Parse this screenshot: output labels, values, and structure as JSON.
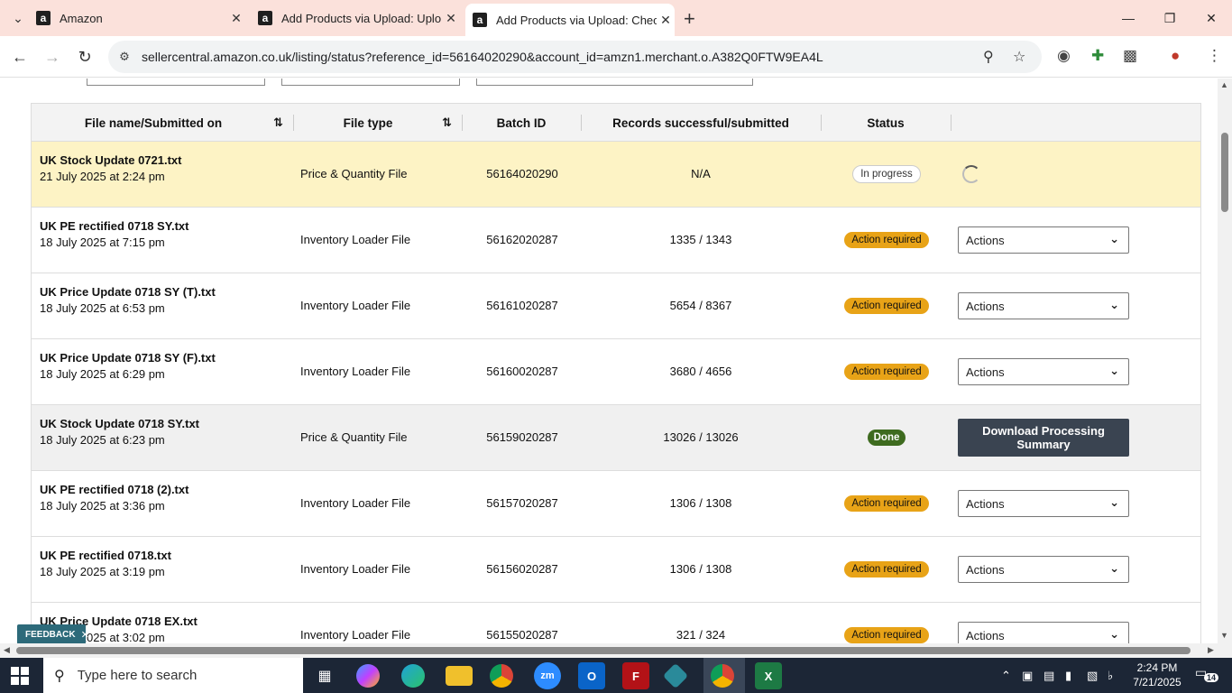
{
  "browser": {
    "tabs": [
      {
        "title": "Amazon",
        "favicon": "a"
      },
      {
        "title": "Add Products via Upload: Uplo",
        "favicon": "a"
      },
      {
        "title": "Add Products via Upload: Chec",
        "favicon": "a",
        "active": true
      }
    ],
    "url": "sellercentral.amazon.co.uk/listing/status?reference_id=56164020290&account_id=amzn1.merchant.o.A382Q0FTW9EA4L"
  },
  "table": {
    "headers": {
      "file": "File name/Submitted on",
      "type": "File type",
      "batch": "Batch ID",
      "records": "Records successful/submitted",
      "status": "Status"
    },
    "rows": [
      {
        "name": "UK Stock Update 0721.txt",
        "date": "21 July 2025 at 2:24 pm",
        "type": "Price & Quantity File",
        "batch": "56164020290",
        "records": "N/A",
        "status": "In progress",
        "action": "spinner"
      },
      {
        "name": "UK PE rectified 0718 SY.txt",
        "date": "18 July 2025 at 7:15 pm",
        "type": "Inventory Loader File",
        "batch": "56162020287",
        "records": "1335 / 1343",
        "status": "Action required",
        "action": "Actions"
      },
      {
        "name": "UK Price Update 0718 SY (T).txt",
        "date": "18 July 2025 at 6:53 pm",
        "type": "Inventory Loader File",
        "batch": "56161020287",
        "records": "5654 / 8367",
        "status": "Action required",
        "action": "Actions"
      },
      {
        "name": "UK Price Update 0718 SY (F).txt",
        "date": "18 July 2025 at 6:29 pm",
        "type": "Inventory Loader File",
        "batch": "56160020287",
        "records": "3680 / 4656",
        "status": "Action required",
        "action": "Actions"
      },
      {
        "name": "UK Stock Update 0718 SY.txt",
        "date": "18 July 2025 at 6:23 pm",
        "type": "Price & Quantity File",
        "batch": "56159020287",
        "records": "13026 / 13026",
        "status": "Done",
        "action": "Download Processing Summary"
      },
      {
        "name": "UK PE rectified 0718 (2).txt",
        "date": "18 July 2025 at 3:36 pm",
        "type": "Inventory Loader File",
        "batch": "56157020287",
        "records": "1306 / 1308",
        "status": "Action required",
        "action": "Actions"
      },
      {
        "name": "UK PE rectified 0718.txt",
        "date": "18 July 2025 at 3:19 pm",
        "type": "Inventory Loader File",
        "batch": "56156020287",
        "records": "1306 / 1308",
        "status": "Action required",
        "action": "Actions"
      },
      {
        "name": "UK Price Update 0718 EX.txt",
        "date": "18 July 2025 at 3:02 pm",
        "type": "Inventory Loader File",
        "batch": "56155020287",
        "records": "321 / 324",
        "status": "Action required",
        "action": "Actions"
      }
    ]
  },
  "feedback": "FEEDBACK",
  "taskbar": {
    "search_placeholder": "Type here to search",
    "time": "2:24 PM",
    "date": "7/21/2025",
    "notifications": "14"
  }
}
